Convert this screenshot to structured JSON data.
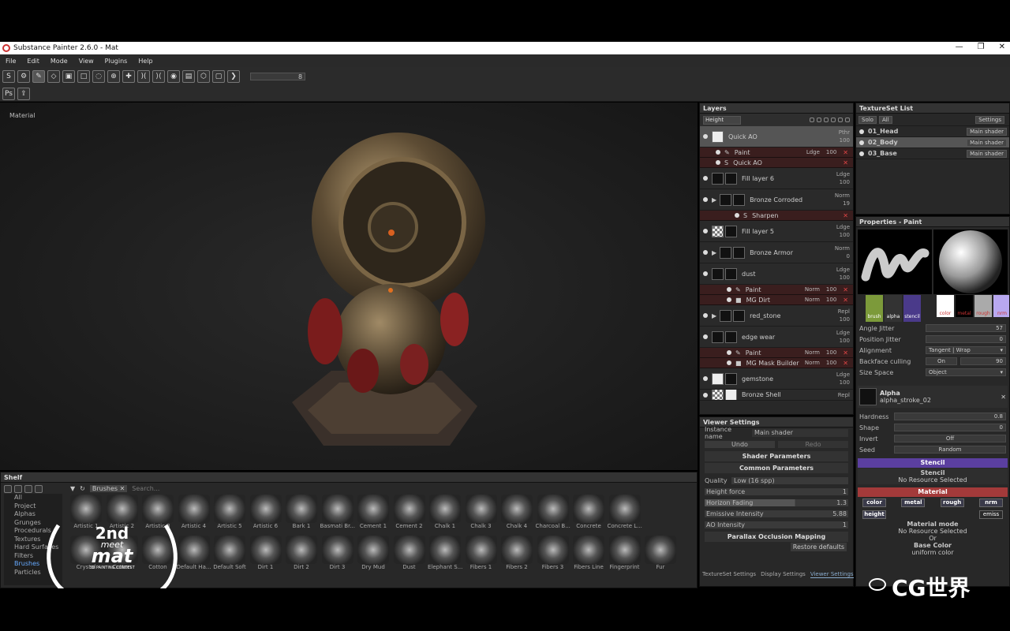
{
  "window": {
    "title": "Substance Painter 2.6.0 - Mat"
  },
  "menu": [
    "File",
    "Edit",
    "Mode",
    "View",
    "Plugins",
    "Help"
  ],
  "toolbar": {
    "slider_value": "8"
  },
  "toolbar2": {
    "ps_label": "Ps"
  },
  "viewport": {
    "label": "Material"
  },
  "layers": {
    "title": "Layers",
    "blend_dropdown": "Height",
    "rows": [
      {
        "name": "Quick AO",
        "blend": "Pthr",
        "opacity": "100"
      },
      {
        "name": "Fill layer 6",
        "blend": "Ldge",
        "opacity": "100"
      },
      {
        "name": "Bronze Corroded",
        "blend": "Norm",
        "opacity": "19"
      },
      {
        "name": "Fill layer 5",
        "blend": "Ldge",
        "opacity": "100"
      },
      {
        "name": "Bronze Armor",
        "blend": "Norm",
        "opacity": "0"
      },
      {
        "name": "dust",
        "blend": "Ldge",
        "opacity": "100"
      },
      {
        "name": "red_stone",
        "blend": "Repl",
        "opacity": "100"
      },
      {
        "name": "edge wear",
        "blend": "Ldge",
        "opacity": "100"
      },
      {
        "name": "gemstone",
        "blend": "Ldge",
        "opacity": "100"
      },
      {
        "name": "Bronze Shell",
        "blend": "Repl",
        "opacity": ""
      }
    ],
    "sub": {
      "quickao_paint": {
        "name": "Paint",
        "blend": "Ldge",
        "opacity": "100"
      },
      "quickao_ao": {
        "name": "Quick AO"
      },
      "bronze_sharpen": {
        "name": "Sharpen"
      },
      "dust_paint": {
        "name": "Paint",
        "blend": "Norm",
        "opacity": "100"
      },
      "dust_mgdirt": {
        "name": "MG Dirt",
        "blend": "Norm",
        "opacity": "100"
      },
      "edge_paint": {
        "name": "Paint",
        "blend": "Norm",
        "opacity": "100"
      },
      "edge_mask": {
        "name": "MG Mask Builder",
        "blend": "Norm",
        "opacity": "100"
      }
    }
  },
  "textureset": {
    "title": "TextureSet List",
    "solo": "Solo",
    "all": "All",
    "settings": "Settings",
    "rows": [
      {
        "name": "01_Head",
        "shader": "Main shader"
      },
      {
        "name": "02_Body",
        "shader": "Main shader"
      },
      {
        "name": "03_Base",
        "shader": "Main shader"
      }
    ]
  },
  "properties": {
    "title": "Properties - Paint",
    "chips": [
      "brush",
      "alpha",
      "stencil"
    ],
    "material_chips": [
      "color",
      "metal",
      "rough",
      "nrm"
    ],
    "angle_jitter": "Angle Jitter",
    "angle_jitter_val": "57",
    "position_jitter": "Position Jitter",
    "position_jitter_val": "0",
    "alignment": "Alignment",
    "alignment_val": "Tangent | Wrap",
    "backface": "Backface culling",
    "backface_on": "On",
    "backface_val": "90",
    "size_space": "Size Space",
    "size_space_val": "Object",
    "alpha_title": "Alpha",
    "alpha_name": "alpha_stroke_02",
    "hardness": "Hardness",
    "hardness_val": "0.8",
    "shape": "Shape",
    "shape_val": "0",
    "invert": "Invert",
    "invert_val": "Off",
    "seed": "Seed",
    "seed_val": "Random",
    "stencil_section": "Stencil",
    "stencil_label": "Stencil",
    "stencil_none": "No Resource Selected",
    "material_section": "Material",
    "mat_buttons": [
      "color",
      "metal",
      "rough",
      "nrm",
      "height",
      "emiss"
    ],
    "material_mode": "Material mode",
    "material_mode_none": "No Resource Selected",
    "or": "Or",
    "base_color": "Base Color",
    "base_color_val": "uniform color"
  },
  "viewer": {
    "title": "Viewer Settings",
    "instance_label": "Instance name",
    "instance_val": "Main shader",
    "undo": "Undo",
    "redo": "Redo",
    "shader_params": "Shader Parameters",
    "common_params": "Common Parameters",
    "quality": "Quality",
    "quality_val": "Low (16 spp)",
    "height_force": "Height force",
    "height_force_val": "1",
    "horizon_fading": "Horizon Fading",
    "horizon_fading_val": "1.3",
    "emissive": "Emissive Intensity",
    "emissive_val": "5.88",
    "ao": "AO Intensity",
    "ao_val": "1",
    "parallax": "Parallax Occlusion Mapping",
    "restore": "Restore defaults"
  },
  "bottom_tabs": [
    "TextureSet Settings",
    "Display Settings",
    "Viewer Settings"
  ],
  "shelf": {
    "title": "Shelf",
    "tab": "Brushes",
    "search": "Search...",
    "categories": [
      "All",
      "Project",
      "Alphas",
      "Grunges",
      "Procedurals",
      "Textures",
      "Hard Surfaces",
      "Filters",
      "Brushes",
      "Particles"
    ],
    "brushes_row1": [
      "Artistic 1",
      "Artistic 2",
      "Artistic 3",
      "Artistic 4",
      "Artistic 5",
      "Artistic 6",
      "Bark 1",
      "Basmati Br...",
      "Cement 1",
      "Cement 2",
      "Chalk 1",
      "Chalk 3",
      "Chalk 4",
      "Charcoal B...",
      "Concrete",
      "Concrete L..."
    ],
    "brushes_row2": [
      "Crystal",
      "Cotton",
      "Cotton",
      "Default Ha...",
      "Default Soft",
      "Dirt 1",
      "Dirt 2",
      "Dirt 3",
      "Dry Mud",
      "Dust",
      "Elephant S...",
      "Fibers 1",
      "Fibers 2",
      "Fibers 3",
      "Fibers Line",
      "Fingerprint",
      "Fur"
    ]
  },
  "overlay": {
    "contest_rank": "2nd",
    "contest_meet": "meet",
    "contest_mat": "mat",
    "contest_sub": "3D PAINTING CONTEST",
    "watermark": "CG世界"
  }
}
